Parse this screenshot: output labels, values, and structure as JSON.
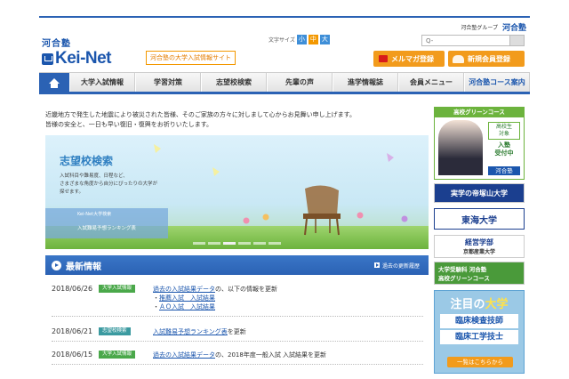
{
  "header": {
    "group_label": "河合塾グループ",
    "group_brand": "河合塾",
    "logo_kawai": "河合塾",
    "logo_name": "Kei-Net",
    "tagline": "河合塾の大学入試情報サイト",
    "font_size_label": "文字サイズ",
    "font_sizes": [
      "小",
      "中",
      "大"
    ],
    "search_placeholder": "Q-",
    "mail_button": "メルマガ登録",
    "register_button": "新規会員登録"
  },
  "nav": {
    "items": [
      "大学入試情報",
      "学習対策",
      "志望校検索",
      "先輩の声",
      "進学情報誌",
      "会員メニュー",
      "河合塾コース案内"
    ]
  },
  "notice": {
    "line1": "近畿地方で発生した地震により被災された皆様、そのご家族の方々に対しまして心からお見舞い申し上げます。",
    "line2": "皆様の安全と、一日も早い復旧・復興をお祈りいたします。"
  },
  "banner": {
    "title": "志望校検索",
    "desc1": "入試科目や難易度、日程など、",
    "desc2": "さまざまな角度から自分にぴったりの大学が",
    "desc3": "探せます。",
    "sub1": "Kei-Net大学検索",
    "sub2": "入試難易予想ランキング表"
  },
  "news": {
    "title": "最新情報",
    "past_link": "過去の更新履歴",
    "rows": [
      {
        "date": "2018/06/26",
        "tag": "大学入試情報",
        "link": "過去の入試結果データ",
        "text": "の、以下の情報を更新",
        "sub1": "推薦入試　入試結果",
        "sub2": "ＡＯ入試　入試結果"
      },
      {
        "date": "2018/06/21",
        "tag": "志望校検索",
        "link": "入試難易予想ランキング表",
        "text": "を更新"
      },
      {
        "date": "2018/06/15",
        "tag": "大学入試情報",
        "link": "過去の入試結果データ",
        "text": "の、2018年度一般入試 入試結果を更新"
      }
    ]
  },
  "sidebar": {
    "ad1_head": "高校グリーンコース",
    "ad1_box1": "高校生",
    "ad1_box2": "対象",
    "ad1_nyu1": "入塾",
    "ad1_nyu2": "受付中",
    "ad1_brand": "河合塾",
    "ad2": "実学の帝塚山大学",
    "ad3": "東海大学",
    "ad4_main": "経営学部",
    "ad4_sub": "京都産業大学",
    "ad5_line1": "大学受験科 河合塾",
    "ad5_line2": "高校グリーンコース",
    "ad6_big_a": "注目の",
    "ad6_big_b": "大学",
    "ad6_l1": "臨床検査技師",
    "ad6_l2": "臨床工学技士",
    "ad6_go": "一覧はこちらから"
  }
}
